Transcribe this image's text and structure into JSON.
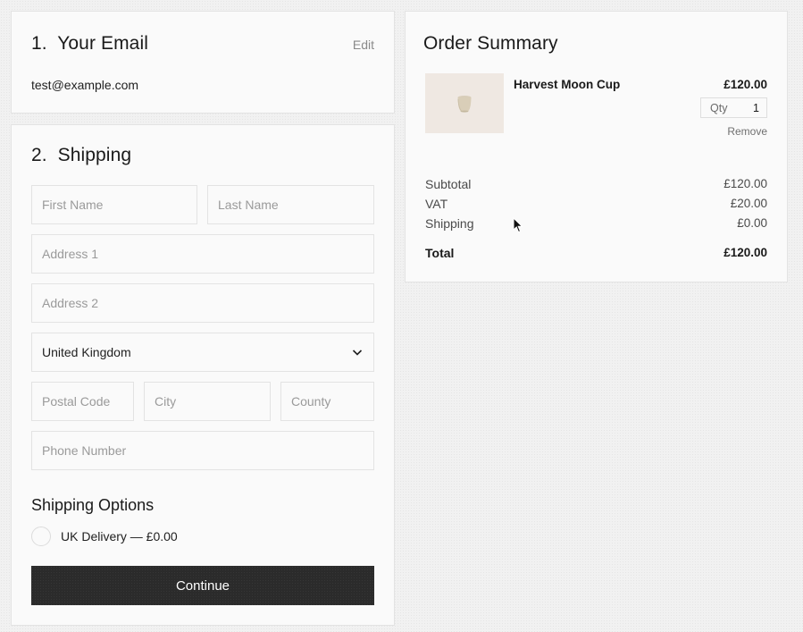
{
  "email_section": {
    "number": "1.",
    "title": "Your Email",
    "edit_label": "Edit",
    "email": "test@example.com"
  },
  "shipping_section": {
    "number": "2.",
    "title": "Shipping",
    "fields": {
      "first_name_placeholder": "First Name",
      "last_name_placeholder": "Last Name",
      "address1_placeholder": "Address 1",
      "address2_placeholder": "Address 2",
      "country_value": "United Kingdom",
      "postal_code_placeholder": "Postal Code",
      "city_placeholder": "City",
      "county_placeholder": "County",
      "phone_placeholder": "Phone Number"
    },
    "options_title": "Shipping Options",
    "options": [
      {
        "label": "UK Delivery — £0.00",
        "selected": false
      }
    ],
    "continue_label": "Continue"
  },
  "order_summary": {
    "title": "Order Summary",
    "item": {
      "name": "Harvest Moon Cup",
      "price": "£120.00",
      "qty_label": "Qty",
      "qty": "1",
      "remove_label": "Remove"
    },
    "totals": [
      {
        "label": "Subtotal",
        "amount": "£120.00"
      },
      {
        "label": "VAT",
        "amount": "£20.00"
      },
      {
        "label": "Shipping",
        "amount": "£0.00"
      }
    ],
    "total": {
      "label": "Total",
      "amount": "£120.00"
    }
  },
  "colors": {
    "button_bg": "#2b2b2b",
    "card_bg": "#fafafa",
    "border": "#e3e3e3"
  }
}
